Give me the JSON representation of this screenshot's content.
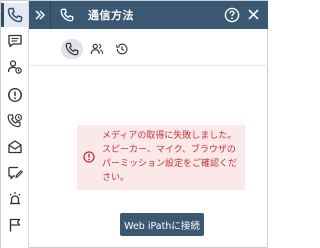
{
  "header": {
    "title": "通信方法",
    "expand_icon": "chevrons-right-icon",
    "phone_icon": "phone-icon",
    "help_icon": "help-circle-icon",
    "close_icon": "close-icon"
  },
  "sidebar": {
    "items": [
      {
        "name": "phone",
        "icon": "phone-icon",
        "active": true
      },
      {
        "name": "chat",
        "icon": "chat-icon"
      },
      {
        "name": "contacts",
        "icon": "contacts-icon"
      },
      {
        "name": "alert",
        "icon": "alert-icon"
      },
      {
        "name": "call-history",
        "icon": "call-history-icon"
      },
      {
        "name": "email",
        "icon": "email-icon"
      },
      {
        "name": "notes",
        "icon": "edit-message-icon"
      },
      {
        "name": "notifications",
        "icon": "siren-icon"
      },
      {
        "name": "flag",
        "icon": "flag-icon"
      }
    ]
  },
  "subtabs": [
    {
      "name": "phone",
      "icon": "phone-icon",
      "active": true
    },
    {
      "name": "people",
      "icon": "people-icon"
    },
    {
      "name": "history",
      "icon": "history-icon"
    }
  ],
  "alert": {
    "icon": "error-circle-icon",
    "message": "メディアの取得に失敗しました。スピーカー、マイク、ブラウザのパーミッション設定をご確認ください。"
  },
  "connect_button": {
    "label": "Web iPathに接続"
  },
  "colors": {
    "header_bg": "#3b5872",
    "alert_bg": "#fbe9ea",
    "alert_text": "#c62f3b",
    "button_bg": "#3b5872"
  }
}
